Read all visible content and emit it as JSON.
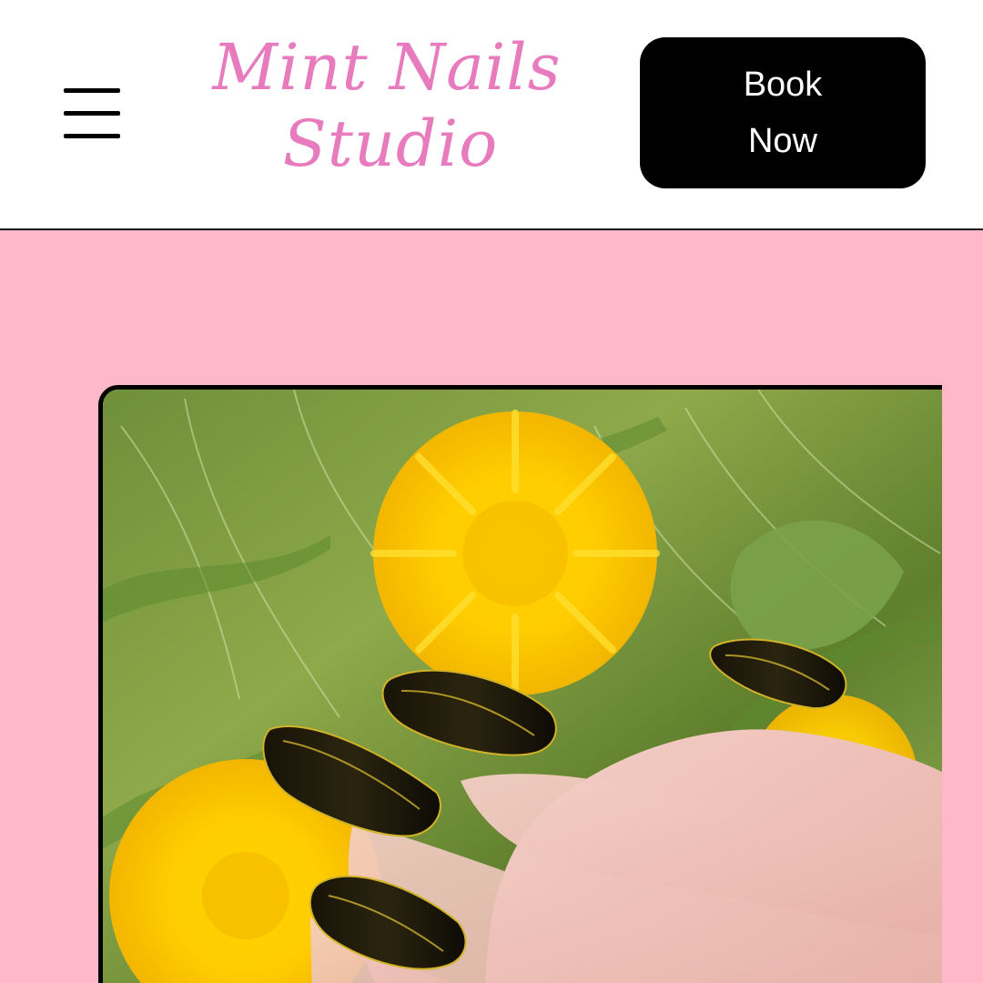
{
  "header": {
    "menu_icon": "hamburger-menu-icon",
    "logo": {
      "line1": "Mint Nails",
      "line2": "Studio"
    },
    "book_button_label": "Book Now"
  },
  "hero": {
    "image": {
      "description_icon": "nail-photo-image"
    }
  },
  "colors": {
    "brand_pink_text": "#e77bbd",
    "hero_background": "#feb8c9",
    "button_background": "#000000",
    "button_text": "#ffffff"
  }
}
